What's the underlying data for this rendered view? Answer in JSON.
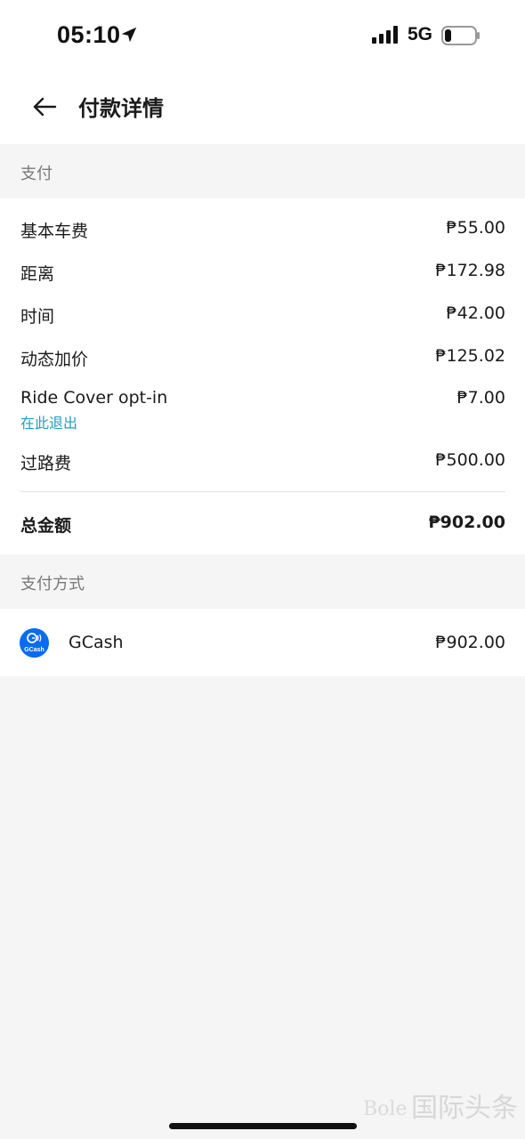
{
  "status_bar": {
    "time": "05:10",
    "network": "5G",
    "icons": [
      "location-arrow-icon",
      "signal-icon",
      "battery-icon"
    ]
  },
  "header": {
    "back_icon": "arrow-left-icon",
    "title": "付款详情"
  },
  "payment_section": {
    "title": "支付",
    "items": [
      {
        "label": "基本车费",
        "value": "₱55.00"
      },
      {
        "label": "距离",
        "value": "₱172.98"
      },
      {
        "label": "时间",
        "value": "₱42.00"
      },
      {
        "label": "动态加价",
        "value": "₱125.02"
      },
      {
        "label": "Ride Cover opt-in",
        "value": "₱7.00",
        "link": "在此退出"
      },
      {
        "label": "过路费",
        "value": "₱500.00"
      }
    ],
    "total": {
      "label": "总金额",
      "value": "₱902.00"
    }
  },
  "payment_method_section": {
    "title": "支付方式",
    "method": {
      "name": "GCash",
      "logo_text": "GCash",
      "amount": "₱902.00"
    }
  },
  "colors": {
    "link": "#1ea0c8",
    "gcash_blue": "#0a6cf0",
    "background": "#f5f5f5",
    "section_text": "#7a7a7a"
  },
  "watermark": {
    "brand": "Bole",
    "text": "国际头条"
  }
}
